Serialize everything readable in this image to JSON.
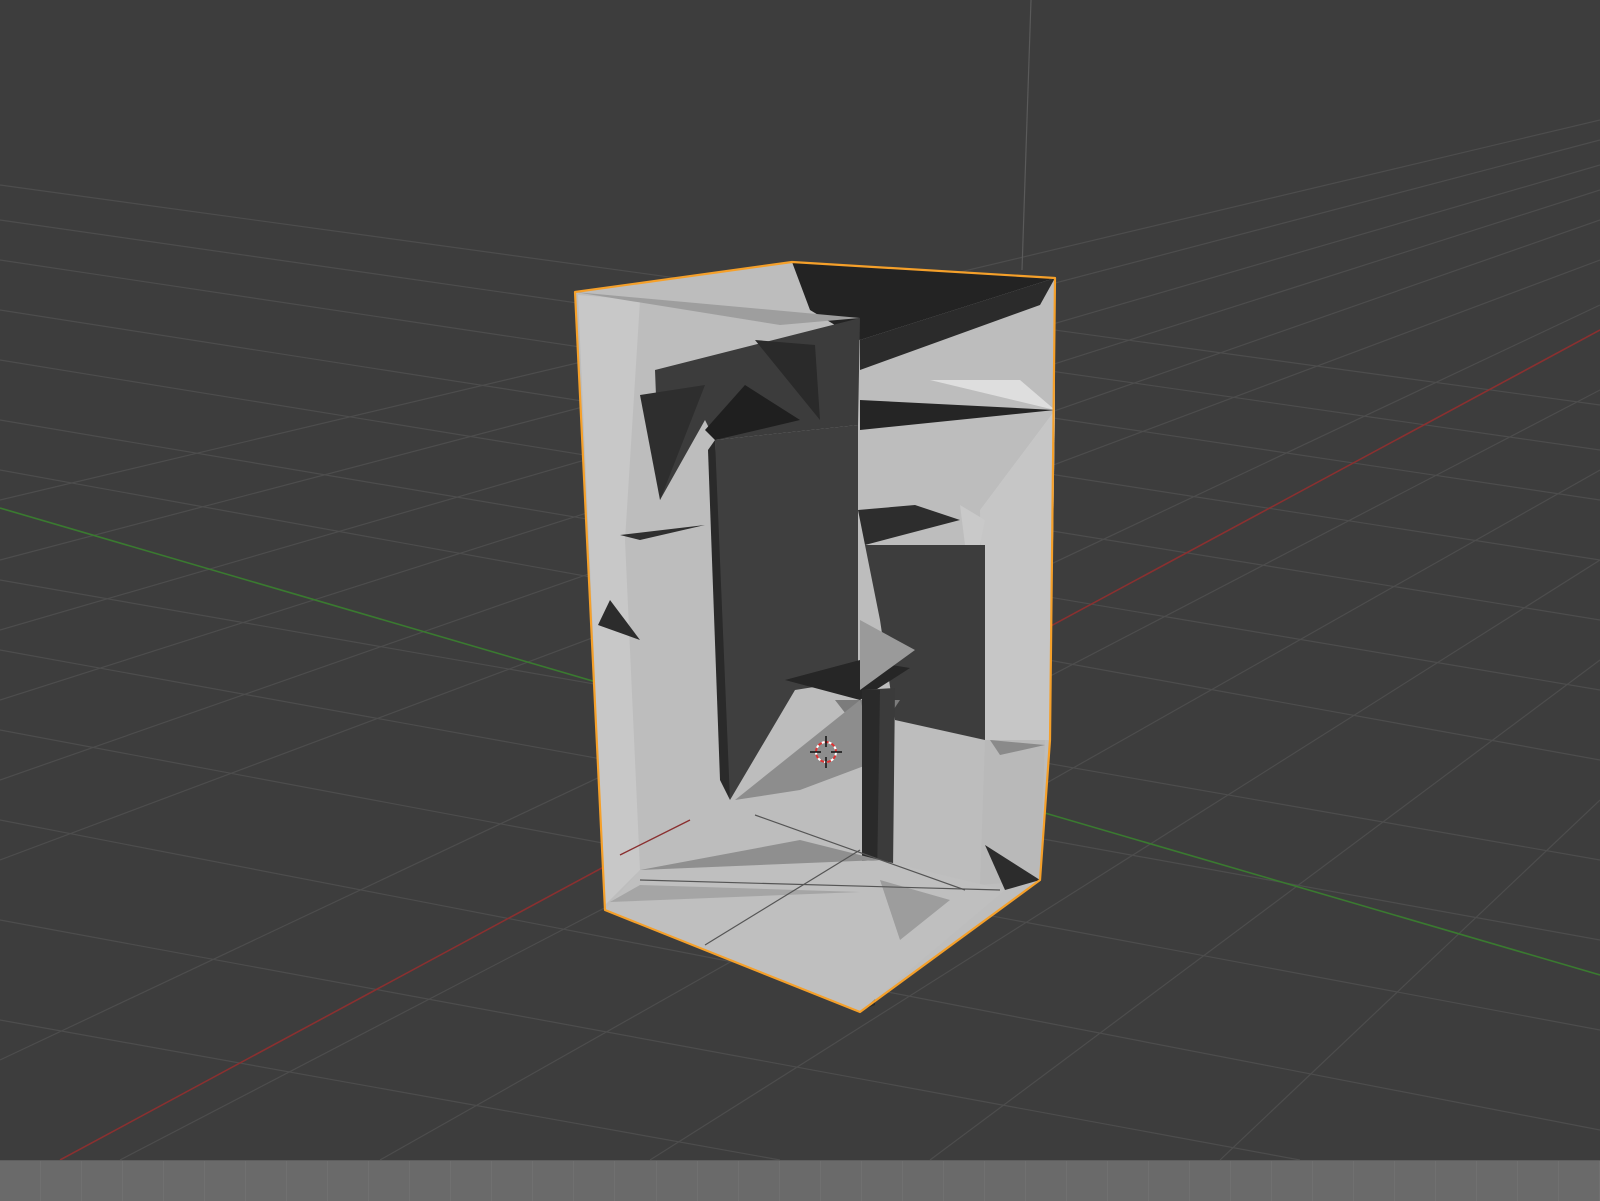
{
  "app": "3D Viewport",
  "scene": {
    "selected_object": "mesh",
    "selection_outline_color": "#f5a02a",
    "background_color": "#3d3d3d",
    "grid_color": "#4c4c4c",
    "x_axis_color": "#8a3030",
    "y_axis_color": "#3a7a30",
    "z_axis_color": "#5a5a5a",
    "icons": [
      "3d-cursor-icon"
    ]
  },
  "timeline": {
    "color": "#6a6a6a",
    "segments": 39
  }
}
